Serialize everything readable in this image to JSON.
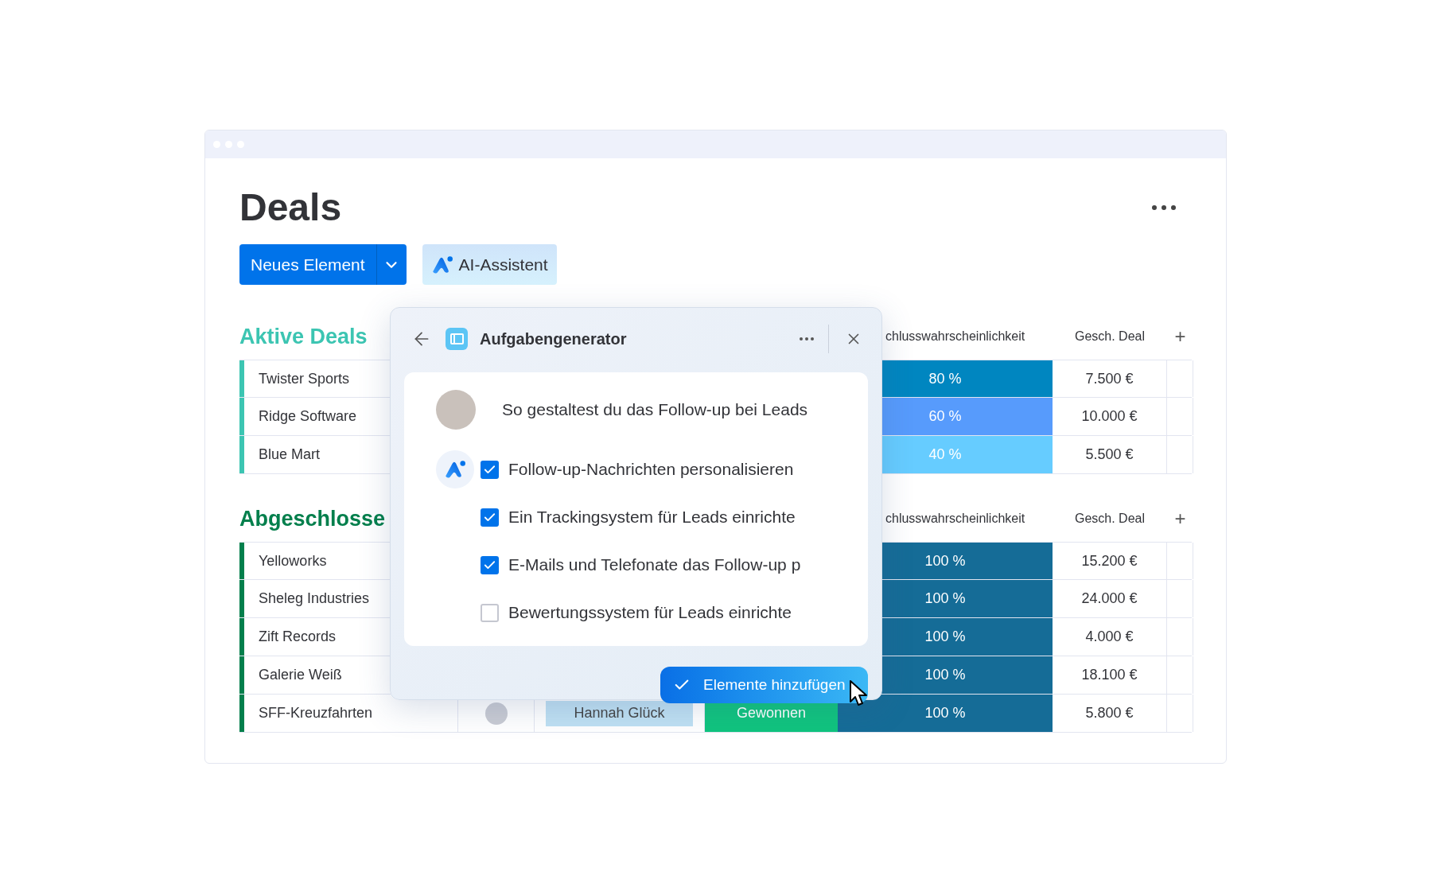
{
  "title": "Deals",
  "toolbar": {
    "new_button": "Neues Element",
    "ai_button": "AI-Assistent"
  },
  "groups": [
    {
      "title": "Aktive Deals",
      "color": "#3cc5b2",
      "columns": [
        "chlusswahrscheinlichkeit",
        "Gesch. Deal",
        "+"
      ],
      "rows": [
        {
          "name": "Twister Sports",
          "probability": "80 %",
          "color": "#0086c0",
          "deal": "7.500 €"
        },
        {
          "name": "Ridge Software",
          "probability": "60 %",
          "color": "#579bfc",
          "deal": "10.000 €"
        },
        {
          "name": "Blue Mart",
          "probability": "40 %",
          "color": "#66ccff",
          "deal": "5.500 €"
        }
      ]
    },
    {
      "title": "Abgeschlosse",
      "color": "#037f4c",
      "columns": [
        "chlusswahrscheinlichkeit",
        "Gesch. Deal",
        "+"
      ],
      "rows": [
        {
          "name": "Yelloworks",
          "probability": "100 %",
          "color": "#156c97",
          "deal": "15.200 €"
        },
        {
          "name": "Sheleg Industries",
          "probability": "100 %",
          "color": "#156c97",
          "deal": "24.000 €"
        },
        {
          "name": "Zift Records",
          "probability": "100 %",
          "color": "#156c97",
          "deal": "4.000 €"
        },
        {
          "name": "Galerie Weiß",
          "probability": "100 %",
          "color": "#156c97",
          "deal": "18.100 €"
        },
        {
          "name": "SFF-Kreuzfahrten",
          "person": "Hannah Glück",
          "status": "Gewonnen",
          "probability": "100 %",
          "color": "#156c97",
          "deal": "5.800 €"
        }
      ]
    }
  ],
  "dialog": {
    "title": "Aufgabengenerator",
    "prompt": "So gestaltest du das Follow-up bei Leads",
    "items": [
      {
        "label": "Follow-up-Nachrichten personalisieren",
        "checked": true
      },
      {
        "label": "Ein Trackingsystem für Leads einrichte",
        "checked": true
      },
      {
        "label": "E-Mails und Telefonate das Follow-up p",
        "checked": true
      },
      {
        "label": "Bewertungssystem für Leads einrichte",
        "checked": false
      }
    ],
    "button": "Elemente hinzufügen"
  }
}
